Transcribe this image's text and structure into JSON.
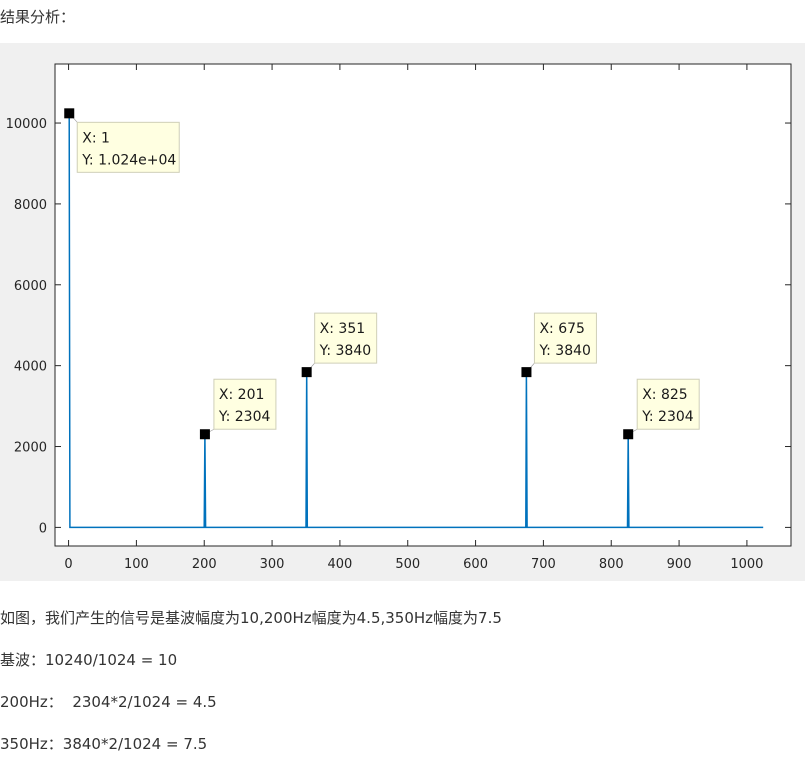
{
  "heading": "结果分析：",
  "chart_data": {
    "type": "line",
    "title": "",
    "xlabel": "",
    "ylabel": "",
    "xlim": [
      -20,
      1065
    ],
    "ylim": [
      -460,
      11460
    ],
    "x_ticks": [
      0,
      100,
      200,
      300,
      400,
      500,
      600,
      700,
      800,
      900,
      1000
    ],
    "y_ticks": [
      0,
      2000,
      4000,
      6000,
      8000,
      10000
    ],
    "x_tick_labels": [
      "0",
      "100",
      "200",
      "300",
      "400",
      "500",
      "600",
      "700",
      "800",
      "900",
      "1000"
    ],
    "y_tick_labels": [
      "0",
      "2000",
      "4000",
      "6000",
      "8000",
      "10000"
    ],
    "grid": false,
    "line_color": "#0072bd",
    "series_x_range": [
      1,
      1024
    ],
    "baseline_value": 0,
    "peaks": [
      {
        "x": 1,
        "y": 10240
      },
      {
        "x": 201,
        "y": 2304
      },
      {
        "x": 351,
        "y": 3840
      },
      {
        "x": 675,
        "y": 3840
      },
      {
        "x": 825,
        "y": 2304
      }
    ],
    "datatips": [
      {
        "x_text": "X: 1",
        "y_text": "Y: 1.024e+04"
      },
      {
        "x_text": "X: 201",
        "y_text": "Y: 2304"
      },
      {
        "x_text": "X: 351",
        "y_text": "Y: 3840"
      },
      {
        "x_text": "X: 675",
        "y_text": "Y: 3840"
      },
      {
        "x_text": "X: 825",
        "y_text": "Y: 2304"
      }
    ]
  },
  "paragraphs": {
    "p1": "如图，我们产生的信号是基波幅度为10,200Hz幅度为4.5,350Hz幅度为7.5",
    "p2": "基波：10240/1024 = 10",
    "p3": "200Hz：  2304*2/1024 = 4.5",
    "p4": "350Hz：3840*2/1024 = 7.5"
  }
}
